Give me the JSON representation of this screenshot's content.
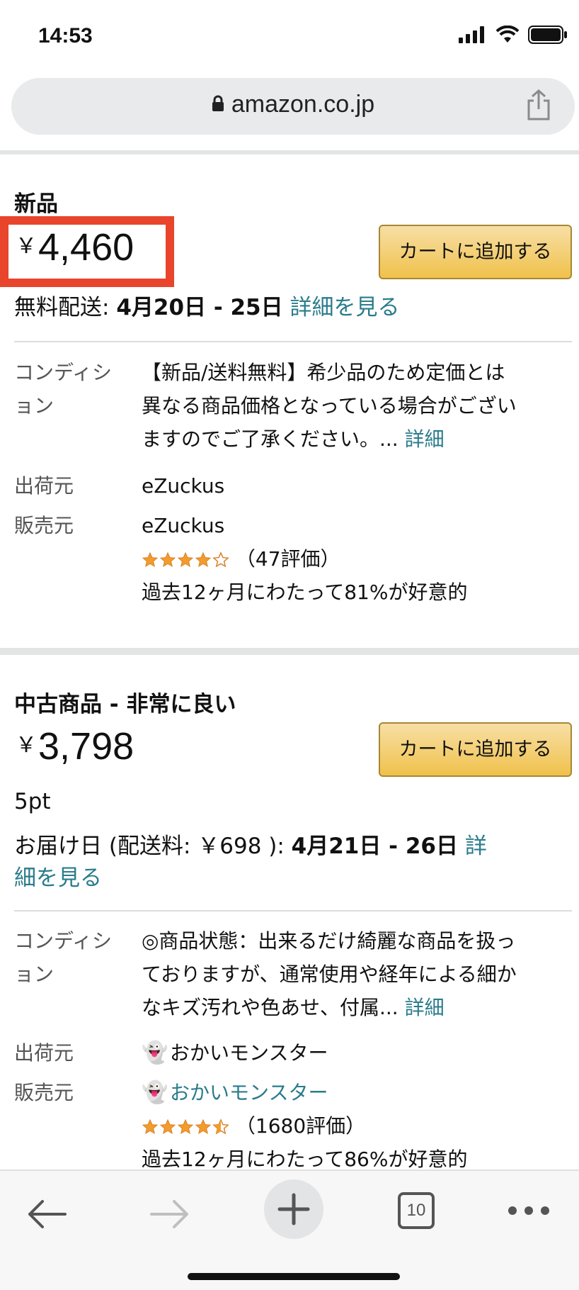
{
  "status_bar": {
    "time": "14:53"
  },
  "browser": {
    "url": "amazon.co.jp",
    "tab_count": "10"
  },
  "offers": [
    {
      "heading": "新品",
      "price_symbol": "￥",
      "price_value": "4,460",
      "cart_label": "カートに追加する",
      "delivery_prefix": "無料配送: ",
      "delivery_dates": "4月20日 - 25日",
      "details_link": " 詳細を見る",
      "condition_label_1": "コンディシ",
      "condition_label_2": "ョン",
      "condition_text_1": "【新品/送料無料】希少品のため定価とは",
      "condition_text_2": "異なる商品価格となっている場合がござい",
      "condition_text_3": "ますのでご了承ください。...",
      "condition_more": " 詳細",
      "shipper_label": "出荷元",
      "shipper": "eZuckus",
      "seller_label": "販売元",
      "seller": "eZuckus",
      "rating_count": "（47評価）",
      "positive_text": "過去12ヶ月にわたって81%が好意的"
    },
    {
      "heading": "中古商品 - 非常に良い",
      "price_symbol": "￥",
      "price_value": "3,798",
      "cart_label": "カートに追加する",
      "points": "5pt",
      "delivery_prefix": "お届け日 (配送料: ￥698 ): ",
      "delivery_dates": "4月21日 - 26日",
      "details_link_1": " 詳",
      "details_link_2": "細を見る",
      "condition_label_1": "コンディシ",
      "condition_label_2": "ョン",
      "condition_text_1": "◎商品状態：出来るだけ綺麗な商品を扱っ",
      "condition_text_2": "ておりますが、通常使用や経年による細か",
      "condition_text_3": "なキズ汚れや色あせ、付属...",
      "condition_more": " 詳細",
      "shipper_label": "出荷元",
      "shipper": "おかいモンスター",
      "seller_label": "販売元",
      "seller": "おかいモンスター",
      "ghost_glyph": "👻",
      "rating_count": "（1680評価）",
      "positive_text": "過去12ヶ月にわたって86%が好意的"
    }
  ],
  "colors": {
    "link": "#2a7c8c",
    "cart_button": "#f0c14b",
    "highlight": "#e8452c",
    "star": "#f39c2b"
  },
  "ratings": {
    "offer1_stars": 4,
    "offer2_stars": 4.5
  }
}
